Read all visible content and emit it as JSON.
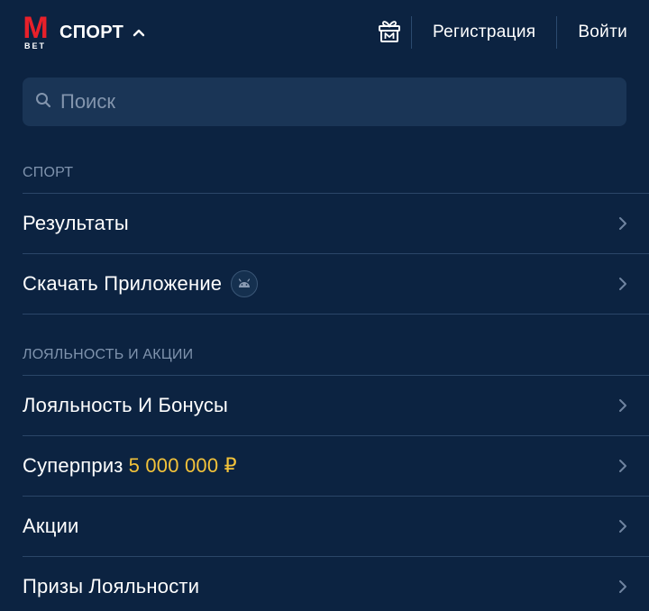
{
  "header": {
    "logo_main": "M",
    "logo_sub": "BET",
    "section_title": "СПОРТ",
    "register_label": "Регистрация",
    "login_label": "Войти"
  },
  "search": {
    "placeholder": "Поиск",
    "value": ""
  },
  "menu": {
    "groups": [
      {
        "label": "СПОРТ",
        "items": [
          {
            "label": "Результаты"
          },
          {
            "label": "Скачать Приложение",
            "badge_icon": "android-icon"
          }
        ]
      },
      {
        "label": "ЛОЯЛЬНОСТЬ И АКЦИИ",
        "items": [
          {
            "label": "Лояльность И Бонусы"
          },
          {
            "label": "Суперприз",
            "accent": "5 000 000 ₽"
          },
          {
            "label": "Акции"
          },
          {
            "label": "Призы Лояльности"
          }
        ]
      }
    ]
  },
  "colors": {
    "background": "#0c2341",
    "brand_red": "#e8202a",
    "accent_gold": "#f2c23a",
    "search_bg": "#1a3556",
    "muted_text": "#7f93ad",
    "divider": "#2b4668"
  }
}
